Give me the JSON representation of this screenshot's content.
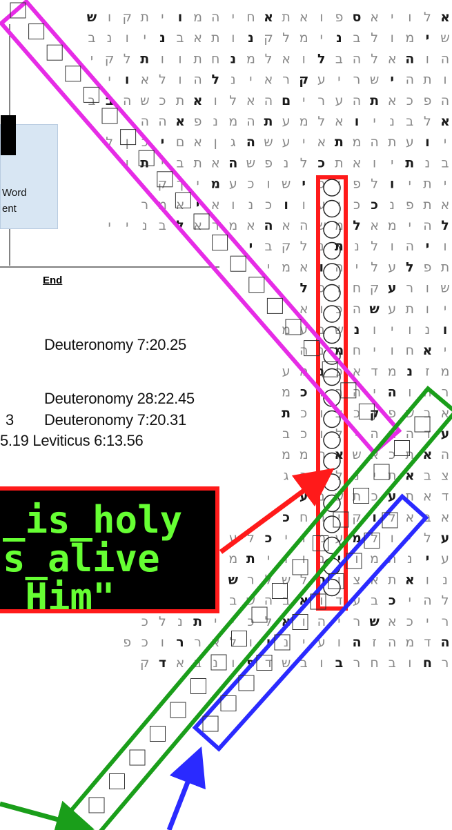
{
  "grid": {
    "rows": [
      "אלויאספואתאחיהמויתקוש",
      "שימולבנימלקנותאבניונב",
      "הוהאלהבלואלמנחתוותלקי",
      "ותהישריעקראינלהולאוי",
      "הפכאתהעריםהאלואתכשהבב",
      "אלבניואלמעתהמנפאהה",
      "יועתהמתאיעשהגןאםיכןל",
      "בנתיואתכלנפשהאתביתו",
      "יתיולפיכישוכעמיךק",
      "אתפנככיעווכנואיאמר",
      "להימאלמשהאהאמראלבניי",
      "ויהולנתנלקבי",
      "תפלעליהואמי",
      "שורעקחוכל",
      "יותעשהכוא",
      "ונויונשבעמ",
      "יאחויחמנה",
      "מזנמדאכנמע",
      "רחוהיהרוכמ",
      "אבשפקכצוכת",
      "עדהההילוכב",
      "האתכאשאתממ",
      "צבאתינלצבג",
      "דאתעכתשבע",
      "אבאלוקירחכ",
      "עליולמעמויכלעדתבניה",
      "עינתמויבוויתמרמויחנ",
      "נואתאצוהלשלרשתאתאר",
      "להיכבעדואבהשבראמיר",
      "ריכאשריהואלכייתנלכ",
      "הדמהזהועיניולאררוכפ",
      "רחובחרבובשדפונבאדק"
    ]
  },
  "icons": {
    "circle_marker": "circled-letter-icon",
    "highlight_square": "highlighted-letter-square-icon",
    "arrow": "pointer-arrow-icon"
  },
  "colors": {
    "grid_letter": "#888888",
    "grid_letter_strong": "#1a1a1a",
    "pink": "#e62ce6",
    "red": "#ff1a1a",
    "green": "#1a9e1a",
    "blue": "#2a2aff",
    "highlight_bg": "#e8e8e8",
    "banner_bg": "#000000",
    "banner_text": "#66ff33",
    "word_box_bg": "#d8e6f3"
  },
  "side_panel": {
    "word_box_line1": "Word",
    "word_box_line2": "ent",
    "end_label": "End",
    "refs": [
      {
        "text": "Deuteronomy 7:20.25"
      },
      {
        "text": "Deuteronomy 28:22.45"
      },
      {
        "text": "3"
      },
      {
        "text": "Deuteronomy 7:20.31"
      },
      {
        "text": "5.19 Leviticus 6:13.56"
      }
    ]
  },
  "banner": {
    "line1": "_is_holy",
    "line2": "s_alive",
    "line3": "_Him\""
  }
}
